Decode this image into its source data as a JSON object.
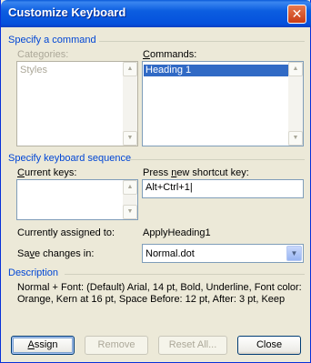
{
  "window": {
    "title": "Customize Keyboard",
    "close_glyph": "✕"
  },
  "specify_command": {
    "group_label": "Specify a command",
    "categories_label": "Categories:",
    "categories_items": [
      "Styles"
    ],
    "commands_label_prefix": "",
    "commands_label_accel": "C",
    "commands_label_rest": "ommands:",
    "commands_items": [
      "Heading 1"
    ]
  },
  "keyboard_sequence": {
    "group_label": "Specify keyboard sequence",
    "current_keys_accel": "C",
    "current_keys_rest": "urrent keys:",
    "press_prefix": "Press ",
    "press_accel": "n",
    "press_rest": "ew shortcut key:",
    "shortcut_value": "Alt+Ctrl+1|",
    "currently_assigned_label": "Currently assigned to:",
    "currently_assigned_value": "ApplyHeading1",
    "save_prefix": "Sa",
    "save_accel": "v",
    "save_rest": "e changes in:",
    "save_value": "Normal.dot"
  },
  "description": {
    "group_label": "Description",
    "lines": [
      "Normal + Font: (Default) Arial, 14 pt, Bold, Underline, Font color:",
      "Orange, Kern at 16 pt, Space Before:  12 pt, After:  3 pt, Keep"
    ]
  },
  "buttons": {
    "assign_accel": "A",
    "assign_rest": "ssign",
    "remove": "Remove",
    "reset_all": "Reset All...",
    "close": "Close"
  },
  "colors": {
    "titlebar": "#0a5ad8",
    "group_label": "#0046d5",
    "selection": "#316ac5",
    "dialog_bg": "#ece9d8"
  },
  "icons": {
    "scroll_up": "▲",
    "scroll_down": "▼",
    "combo_arrow": "▼"
  }
}
